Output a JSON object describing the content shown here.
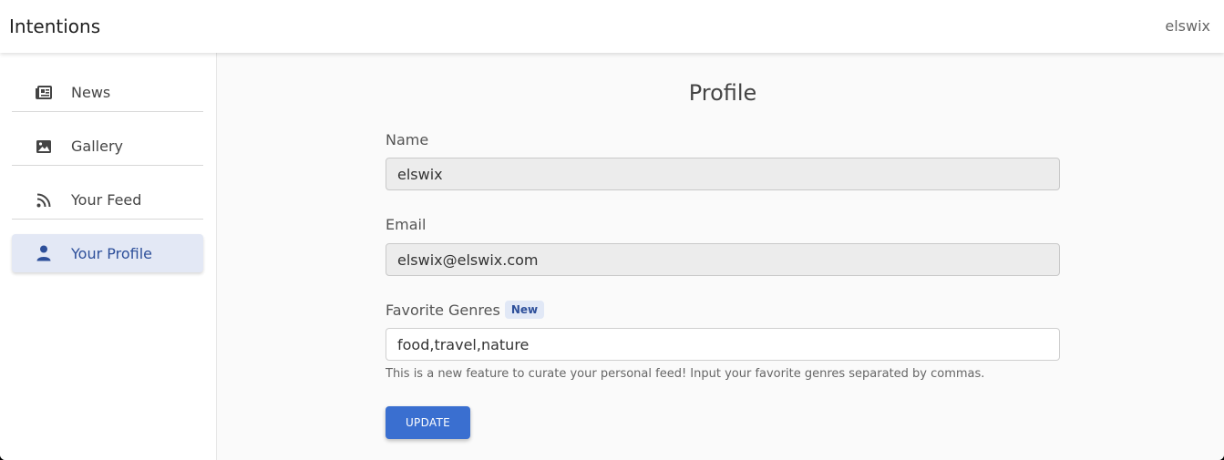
{
  "header": {
    "title": "Intentions",
    "username": "elswix"
  },
  "sidebar": {
    "items": [
      {
        "label": "News",
        "icon": "newspaper-icon"
      },
      {
        "label": "Gallery",
        "icon": "image-icon"
      },
      {
        "label": "Your Feed",
        "icon": "rss-icon"
      },
      {
        "label": "Your Profile",
        "icon": "person-icon",
        "active": true
      }
    ]
  },
  "profile": {
    "title": "Profile",
    "name_label": "Name",
    "name_value": "elswix",
    "email_label": "Email",
    "email_value": "elswix@elswix.com",
    "genres_label": "Favorite Genres",
    "genres_badge": "New",
    "genres_value": "food,travel,nature",
    "genres_help": "This is a new feature to curate your personal feed! Input your favorite genres separated by commas.",
    "update_label": "UPDATE"
  },
  "colors": {
    "accent": "#3a6fd0",
    "active_bg": "#e3e8f5",
    "active_text": "#2d4f9a"
  }
}
